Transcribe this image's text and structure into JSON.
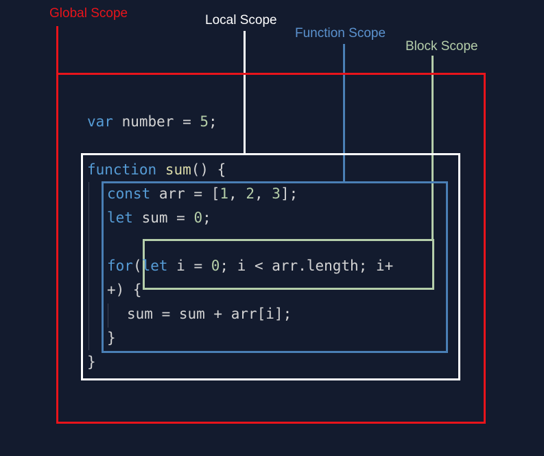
{
  "labels": {
    "global": "Global Scope",
    "local": "Local Scope",
    "function": "Function Scope",
    "block": "Block Scope"
  },
  "colors": {
    "background": "#131b2e",
    "global": "#e8141b",
    "local": "#ffffff",
    "function": "#4a7fb5",
    "block": "#b5ceaa",
    "keyword": "#569cd6",
    "function_name": "#dcdcaa",
    "number": "#b5cea8",
    "text": "#d4d4d4"
  },
  "code": {
    "line1": {
      "kw": "var",
      "rest": " number = ",
      "num": "5",
      "end": ";"
    },
    "line2": {
      "kw": "function",
      "sp": " ",
      "fn": "sum",
      "rest": "() {"
    },
    "line3": {
      "kw": "const",
      "rest": " arr = [",
      "n1": "1",
      "c1": ", ",
      "n2": "2",
      "c2": ", ",
      "n3": "3",
      "end": "];"
    },
    "line4": {
      "kw": "let",
      "rest": " sum = ",
      "num": "0",
      "end": ";"
    },
    "line5": {
      "kw1": "for",
      "p": "(",
      "kw2": "let",
      "rest": " i = ",
      "num": "0",
      "end": "; i < arr.length; i+"
    },
    "line6": {
      "text": "+) {"
    },
    "line7": {
      "text": "sum = sum + arr[i];"
    },
    "line8": {
      "text": "}"
    },
    "line9": {
      "text": "}"
    }
  }
}
